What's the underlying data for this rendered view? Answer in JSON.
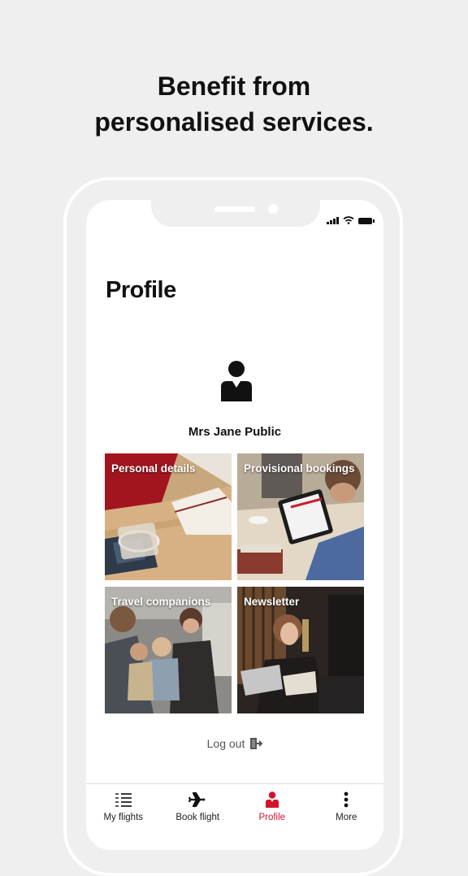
{
  "headline": {
    "line1": "Benefit from",
    "line2": "personalised services."
  },
  "colors": {
    "accent": "#d3132e",
    "background": "#efefef"
  },
  "profile": {
    "title": "Profile",
    "user_name": "Mrs Jane Public",
    "avatar_icon": "person-icon"
  },
  "tiles": [
    {
      "label": "Personal details"
    },
    {
      "label": "Provisional bookings"
    },
    {
      "label": "Travel companions"
    },
    {
      "label": "Newsletter"
    }
  ],
  "logout": {
    "label": "Log out",
    "icon": "logout-icon"
  },
  "tabbar": {
    "items": [
      {
        "label": "My flights",
        "icon": "list-icon"
      },
      {
        "label": "Book flight",
        "icon": "airplane-icon"
      },
      {
        "label": "Profile",
        "icon": "person-icon",
        "active": true
      },
      {
        "label": "More",
        "icon": "more-vertical-icon"
      }
    ]
  }
}
